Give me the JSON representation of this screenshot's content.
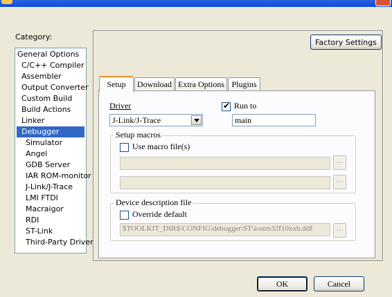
{
  "category_label": "Category:",
  "categories": [
    {
      "label": "General Options",
      "level": 0
    },
    {
      "label": "C/C++ Compiler",
      "level": 1
    },
    {
      "label": "Assembler",
      "level": 1
    },
    {
      "label": "Output Converter",
      "level": 1
    },
    {
      "label": "Custom Build",
      "level": 1
    },
    {
      "label": "Build Actions",
      "level": 1
    },
    {
      "label": "Linker",
      "level": 1
    },
    {
      "label": "Debugger",
      "level": 1,
      "selected": true
    },
    {
      "label": "Simulator",
      "level": 2
    },
    {
      "label": "Angel",
      "level": 2
    },
    {
      "label": "GDB Server",
      "level": 2
    },
    {
      "label": "IAR ROM-monitor",
      "level": 2
    },
    {
      "label": "J-Link/J-Trace",
      "level": 2
    },
    {
      "label": "LMI FTDI",
      "level": 2
    },
    {
      "label": "Macraigor",
      "level": 2
    },
    {
      "label": "RDI",
      "level": 2
    },
    {
      "label": "ST-Link",
      "level": 2
    },
    {
      "label": "Third-Party Driver",
      "level": 2
    }
  ],
  "factory_settings": "Factory Settings",
  "tabs": [
    "Setup",
    "Download",
    "Extra Options",
    "Plugins"
  ],
  "setup": {
    "driver_label": "Driver",
    "driver_value": "J-Link/J-Trace",
    "run_to_label": "Run to",
    "run_to_checked": true,
    "run_to_value": "main",
    "macros_group": "Setup macros",
    "use_macro_label": "Use macro file(s)",
    "ellipsis": "...",
    "device_group": "Device description file",
    "override_label": "Override default",
    "device_path": "$TOOLKIT_DIR$\\CONFIG\\debugger\\ST\\iostm32f10xxb.ddf"
  },
  "ok_label": "OK",
  "cancel_label": "Cancel",
  "colors": {
    "selection": "#316ac5",
    "active_tab": "#e68b2c",
    "dialog_bg": "#ece9d8"
  }
}
